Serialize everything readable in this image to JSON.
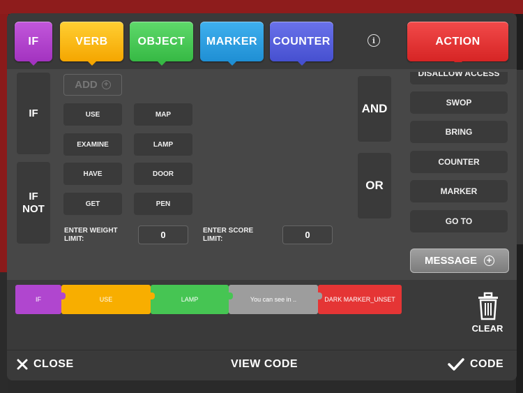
{
  "tabs": {
    "if": "IF",
    "verb": "VERB",
    "object": "OBJECT",
    "marker": "MARKER",
    "counter": "COUNTER",
    "action": "ACTION"
  },
  "info_glyph": "i",
  "conditions": {
    "if": "IF",
    "if_not_line1": "IF",
    "if_not_line2": "NOT"
  },
  "add_label": "ADD",
  "items": [
    {
      "label": "USE"
    },
    {
      "label": "MAP"
    },
    {
      "label": "EXAMINE"
    },
    {
      "label": "LAMP"
    },
    {
      "label": "HAVE"
    },
    {
      "label": "DOOR"
    },
    {
      "label": "GET"
    },
    {
      "label": "PEN"
    }
  ],
  "limits": {
    "weight_label_line1": "ENTER WEIGHT",
    "weight_label_line2": "LIMIT:",
    "weight_value": "0",
    "score_label_line1": "ENTER SCORE",
    "score_label_line2": "LIMIT:",
    "score_value": "0"
  },
  "logic": {
    "and": "AND",
    "or": "OR"
  },
  "actions": [
    {
      "label": "DISALLOW ACCESS"
    },
    {
      "label": "SWOP"
    },
    {
      "label": "BRING"
    },
    {
      "label": "COUNTER"
    },
    {
      "label": "MARKER"
    },
    {
      "label": "GO TO"
    }
  ],
  "message_label": "MESSAGE",
  "rule": {
    "if": "IF",
    "verb": "USE",
    "object": "LAMP",
    "message": "You can see in ..",
    "action": "DARK MARKER_UNSET"
  },
  "clear_label": "CLEAR",
  "footer": {
    "close": "CLOSE",
    "view_code": "VIEW CODE",
    "code": "CODE"
  },
  "colors": {
    "if": "#a333c0",
    "verb": "#f5a600",
    "object": "#36b944",
    "marker": "#1f8fd4",
    "counter": "#4650d0",
    "action": "#d62424"
  }
}
